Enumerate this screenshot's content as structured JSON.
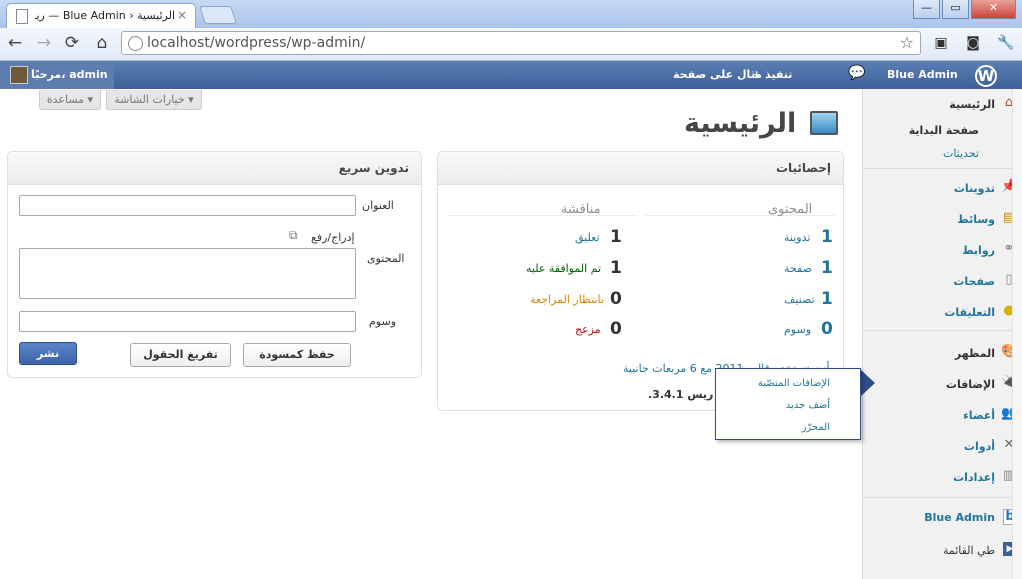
{
  "browser": {
    "tab_title": "الرئيسية ‹ Blue Admin — ريس",
    "tab_close": "×",
    "url": "localhost/wordpress/wp-admin/",
    "window_buttons": [
      "—",
      "▭",
      "✕"
    ]
  },
  "adminbar": {
    "howdy": "مرحبًا، admin",
    "site_name": "Blue Admin",
    "new_label": "+ تنفيذ",
    "new_sub": "مثال على صفحة",
    "comments_icon": "speech-bubble-icon",
    "wp_icon": "wordpress-logo-icon"
  },
  "screen_meta": {
    "options": "خيارات الشاشة ▾",
    "help": "مساعدة ▾"
  },
  "sidebar": {
    "dashboard": "الرئيسية",
    "home": "صفحة البداية",
    "updates": "تحديثات",
    "posts": "تدوينات",
    "media": "وسائط",
    "links": "روابط",
    "pages": "صفحات",
    "comments": "التعليقات",
    "appearance": "المظهر",
    "plugins": "الإضافات",
    "users": "أعضاء",
    "tools": "أدوات",
    "settings": "إعدادات",
    "blue_admin": "Blue Admin",
    "collapse": "طي القائمة"
  },
  "page": {
    "title": "الرئيسية"
  },
  "stats": {
    "heading": "إحصائيات",
    "content_col": "المحتوى",
    "discussion_col": "مناقشة",
    "content": [
      {
        "num": "1",
        "label": "تدوينة"
      },
      {
        "num": "1",
        "label": "صفحة"
      },
      {
        "num": "1",
        "label": "تصنيف"
      },
      {
        "num": "0",
        "label": "وسوم"
      }
    ],
    "discussion": [
      {
        "num": "1",
        "label": "تعليق"
      },
      {
        "num": "1",
        "label": "تم الموافقة عليه"
      },
      {
        "num": "0",
        "label": "بانتظار المراجعة"
      },
      {
        "num": "0",
        "label": "مزعج"
      }
    ],
    "theme_line": "أنت تستخدم قالب 2011 مع 6 مربعات جانبية",
    "version_line": ".3.4.1 ريس"
  },
  "quick_press": {
    "heading": "تدوين سريع",
    "title_label": "العنوان",
    "upload_label": "إدراج/رفع",
    "content_label": "المحتوى",
    "tags_label": "وسوم",
    "save_draft": "حفظ كمسودة",
    "reset": "تفريغ الحقول",
    "publish": "نشر"
  },
  "plugins_flyout": {
    "items": [
      "الإضافات المنصّبة",
      "أضف جديد",
      "المحرّر"
    ]
  }
}
